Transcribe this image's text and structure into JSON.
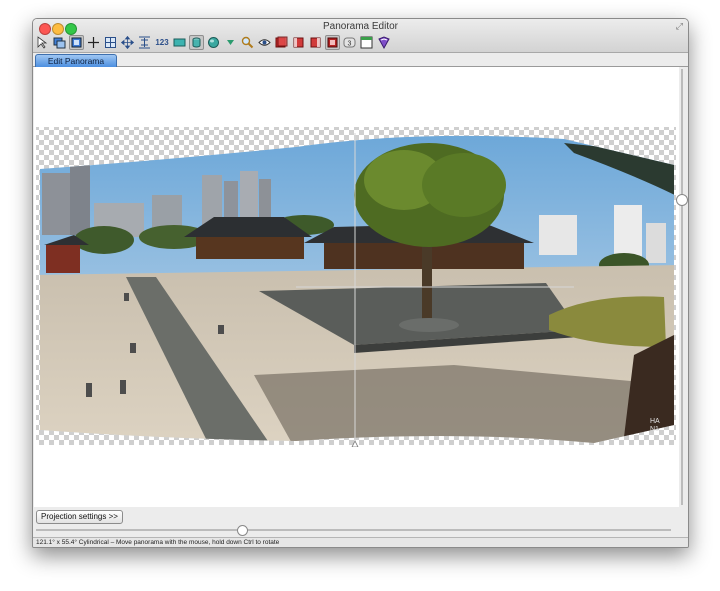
{
  "window": {
    "title": "Panorama Editor"
  },
  "toolbar": {
    "buttons": [
      {
        "icon": "select-pointer-icon"
      },
      {
        "icon": "open-images-icon"
      },
      {
        "icon": "preview-icon",
        "selected": true
      },
      {
        "icon": "crosshair-icon"
      },
      {
        "icon": "center-icon"
      },
      {
        "icon": "move-icon"
      },
      {
        "icon": "fit-icon"
      },
      {
        "icon": "numbers-icon",
        "label": "123"
      },
      {
        "icon": "straighten-icon"
      },
      {
        "icon": "cylinder-icon",
        "selected": true
      },
      {
        "icon": "sphere-icon"
      },
      {
        "icon": "dropdown-arrow-icon"
      },
      {
        "icon": "magnifier-icon"
      },
      {
        "icon": "eye-icon"
      },
      {
        "icon": "red-stack-icon"
      },
      {
        "icon": "red-stack-left-icon"
      },
      {
        "icon": "red-stack-right-icon"
      },
      {
        "icon": "red-frame-icon",
        "selected": true
      },
      {
        "icon": "badge-3-icon"
      },
      {
        "icon": "layout-icon"
      },
      {
        "icon": "book-icon"
      }
    ]
  },
  "tabs": [
    {
      "label": "Edit Panorama",
      "active": true
    }
  ],
  "controls": {
    "projection_button": "Projection settings >>"
  },
  "status": {
    "text": "121.1° x 55.4° Cylindrical – Move panorama with the mouse, hold down Ctrl to rotate"
  },
  "panorama": {
    "overlay_text": "HA\nN1"
  }
}
